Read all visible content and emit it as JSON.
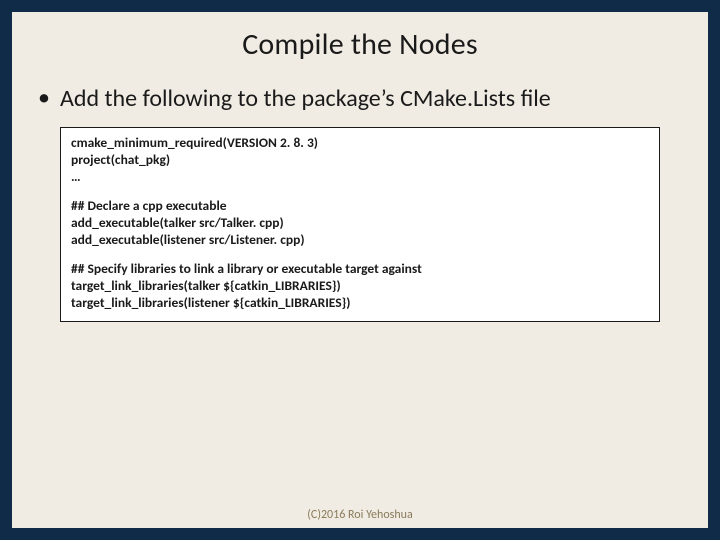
{
  "title": "Compile the Nodes",
  "bullet": "Add the following to the package’s CMake.Lists file",
  "code": {
    "l1": "cmake_minimum_required(VERSION 2. 8. 3)",
    "l2": "project(chat_pkg)",
    "l3": "…",
    "l4": "## Declare a cpp executable",
    "l5": "add_executable(talker src/Talker. cpp)",
    "l6": "add_executable(listener src/Listener. cpp)",
    "l7": "## Specify libraries to link a library or executable target against",
    "l8": "target_link_libraries(talker ${catkin_LIBRARIES})",
    "l9": "target_link_libraries(listener ${catkin_LIBRARIES})"
  },
  "footer": "(C)2016 Roi Yehoshua"
}
